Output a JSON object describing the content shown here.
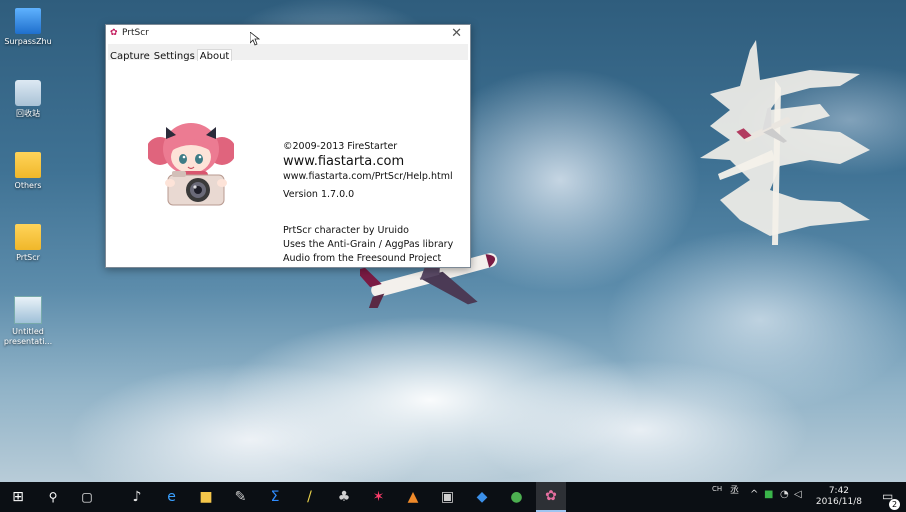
{
  "desktop": {
    "icons": [
      {
        "label": "SurpassZhu",
        "icon": "computer-icon"
      },
      {
        "label": "回收站",
        "icon": "recycle-bin-icon"
      },
      {
        "label": "Others",
        "icon": "folder-icon"
      },
      {
        "label": "PrtScr",
        "icon": "folder-icon"
      },
      {
        "label": "Untitled presentati...",
        "icon": "presentation-file-icon"
      }
    ]
  },
  "window": {
    "title": "PrtScr",
    "close_glyph": "✕",
    "tabs": [
      {
        "label": "Capture",
        "active": false
      },
      {
        "label": "Settings",
        "active": false
      },
      {
        "label": "About",
        "active": true
      }
    ],
    "about": {
      "copyright": "©2009-2013 FireStarter",
      "website": "www.fiastarta.com",
      "help_url": "www.fiastarta.com/PrtScr/Help.html",
      "version": "Version 1.7.0.0",
      "credit_character": "PrtScr character by Uruido",
      "credit_library": "Uses the Anti-Grain / AggPas library",
      "credit_audio": "Audio from the Freesound Project"
    }
  },
  "taskbar": {
    "start_glyph": "⊞",
    "search_glyph": "⚲",
    "taskview_glyph": "▢",
    "apps": [
      {
        "name": "music-app",
        "glyph": "♪",
        "color": "#e6e6e6"
      },
      {
        "name": "internet-explorer",
        "glyph": "e",
        "color": "#3aa0ff"
      },
      {
        "name": "file-explorer",
        "glyph": "■",
        "color": "#f5c64a"
      },
      {
        "name": "paint-app",
        "glyph": "✎",
        "color": "#c9c9c9"
      },
      {
        "name": "sigma-app",
        "glyph": "Σ",
        "color": "#2f8cff"
      },
      {
        "name": "brush-app",
        "glyph": "/",
        "color": "#e8d14a"
      },
      {
        "name": "game-app",
        "glyph": "♣",
        "color": "#d0d0d0"
      },
      {
        "name": "dots-app",
        "glyph": "✶",
        "color": "#ff3d6b"
      },
      {
        "name": "matlab-app",
        "glyph": "▲",
        "color": "#f08a2a"
      },
      {
        "name": "image-viewer",
        "glyph": "▣",
        "color": "#cfcfcf"
      },
      {
        "name": "dropbox-app",
        "glyph": "◆",
        "color": "#3b8fe8"
      },
      {
        "name": "chrome-app",
        "glyph": "●",
        "color": "#4caf50"
      },
      {
        "name": "prtscr-app",
        "glyph": "✿",
        "color": "#e66fa0"
      }
    ],
    "tray": {
      "ime_lang": "CH",
      "ime_mode": "丞",
      "chevron": "^",
      "time": "7:42",
      "date": "2016/11/8",
      "notifications": "2"
    }
  },
  "colors": {
    "taskbar_bg": "#0b0f14",
    "window_border": "#7d8a96",
    "active_indicator": "#9ec4f0"
  }
}
